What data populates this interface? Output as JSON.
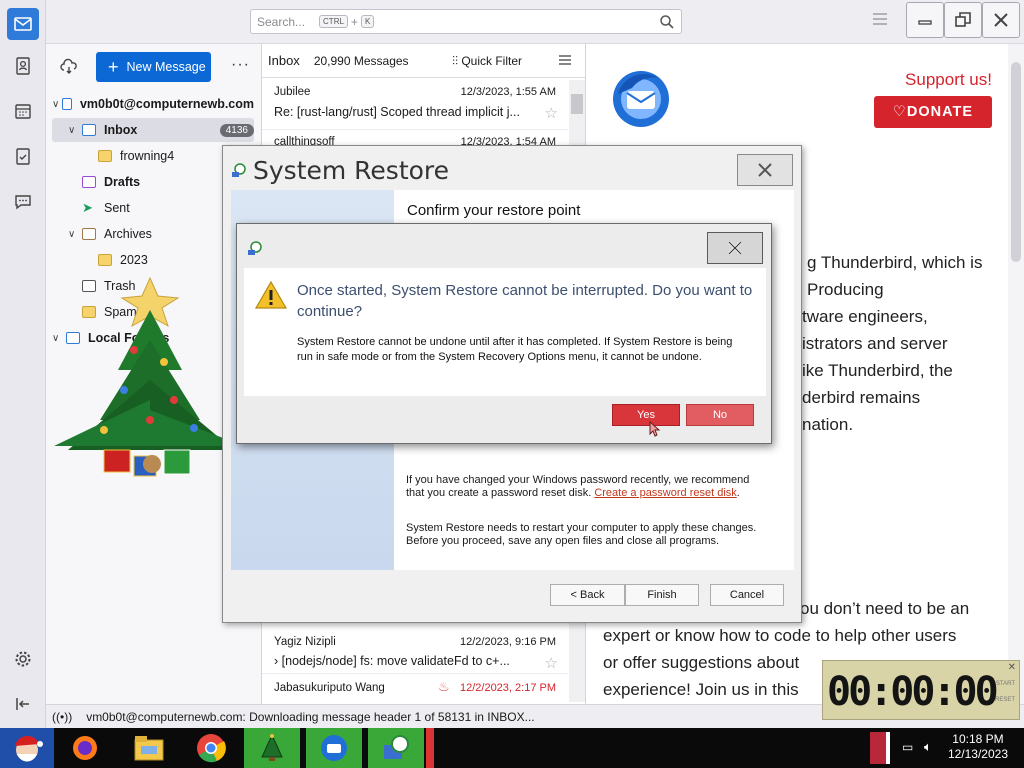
{
  "search": {
    "placeholder": "Search...",
    "kbd1": "CTRL",
    "plus": "+",
    "kbd2": "K"
  },
  "toolbar": {
    "new_message": "New Message",
    "more": "···"
  },
  "account": "vm0b0t@computernewb.com",
  "folders": [
    {
      "label": "Inbox",
      "badge": "4136"
    },
    {
      "label": "frowning4"
    },
    {
      "label": "Drafts"
    },
    {
      "label": "Sent"
    },
    {
      "label": "Archives"
    },
    {
      "label": "2023"
    },
    {
      "label": "Trash"
    },
    {
      "label": "Spam"
    },
    {
      "label": "Local Folders"
    }
  ],
  "message_list": {
    "folder": "Inbox",
    "count": "20,990 Messages",
    "quick_filter": "Quick Filter",
    "messages": [
      {
        "from": "Jubilee",
        "date": "12/3/2023, 1:55 AM",
        "subject": "Re: [rust-lang/rust] Scoped thread implicit j..."
      },
      {
        "from": "callthingsoff",
        "date": "12/3/2023, 1:54 AM",
        "subject": ""
      },
      {
        "from": "Yagiz Nizipli",
        "date": "12/2/2023, 9:16 PM",
        "subject": "[nodejs/node] fs: move validateFd to c+..."
      },
      {
        "from": "Jabasukuriputo Wang",
        "date": "12/2/2023, 2:17 PM",
        "subject": ""
      }
    ]
  },
  "reader": {
    "support": "Support us!",
    "donate": "DONATE",
    "lines_a": [
      "g Thunderbird, which is",
      " Producing",
      "tware engineers,",
      "istrators and server",
      "ike Thunderbird, the",
      "derbird remains",
      "nation."
    ],
    "lines_b": [
      "ou don’t need to be an",
      "expert or know how to code to help other users",
      "or offer suggestions about",
      "experience! Join us in this"
    ]
  },
  "wizard": {
    "title": "System Restore",
    "heading": "Confirm your restore point",
    "para1_text": "If you have changed your Windows password recently, we recommend that you create a password reset disk. ",
    "para1_link": "Create a password reset disk",
    "para1_end": ".",
    "para2": "System Restore needs to restart your computer to apply these changes. Before you proceed, save any open files and close all programs.",
    "back": "< Back",
    "finish": "Finish",
    "cancel": "Cancel"
  },
  "dialog": {
    "instruction": "Once started, System Restore cannot be interrupted. Do you want to continue?",
    "detail": "System Restore cannot be undone until after it has completed. If System Restore is being run in safe mode or from the System Recovery Options menu, it cannot be undone.",
    "yes": "Yes",
    "no": "No"
  },
  "status": {
    "text": "vm0b0t@computernewb.com: Downloading message header 1 of 58131 in INBOX..."
  },
  "timer": {
    "display": "00:00:00",
    "start": "START",
    "reset": "RESET",
    "close": "✕"
  },
  "clock": {
    "time": "10:18 PM",
    "date": "12/13/2023"
  },
  "colors": {
    "accent": "#0b68d4",
    "donate": "#d6242d",
    "yes_button": "#d9363c"
  }
}
